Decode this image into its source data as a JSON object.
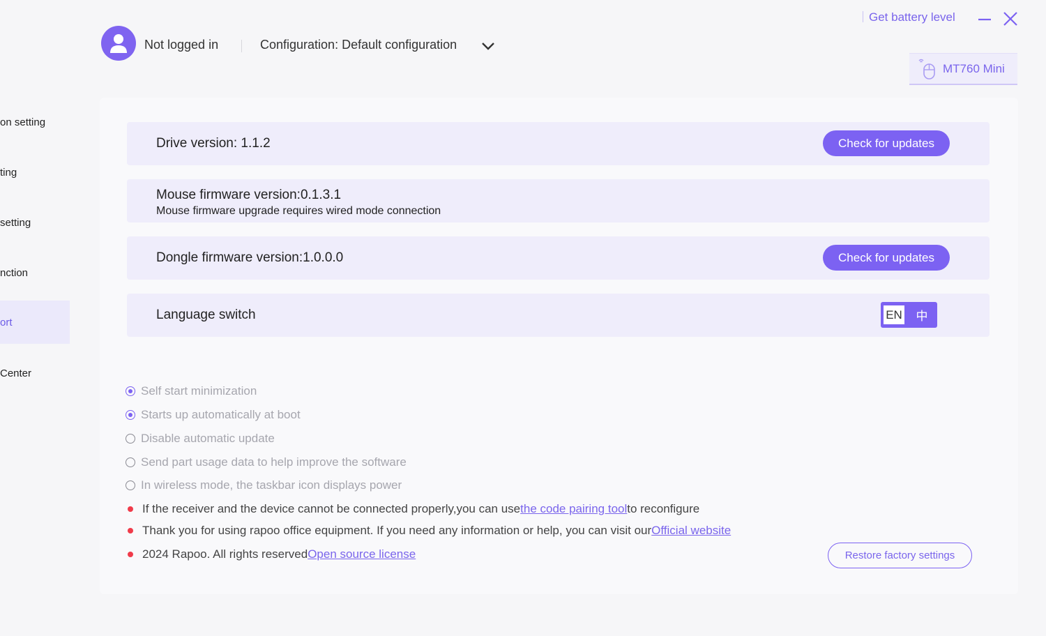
{
  "sidebar": {
    "items": [
      {
        "label": "on setting"
      },
      {
        "label": "ting"
      },
      {
        "label": "setting"
      },
      {
        "label": "nction"
      },
      {
        "label": "ort",
        "active": true
      },
      {
        "label": "Center"
      }
    ]
  },
  "header": {
    "user_status": "Not logged in",
    "configuration": "Configuration: Default configuration",
    "battery_link": "Get battery level",
    "device_name": "MT760 Mini"
  },
  "rows": {
    "drive_version": "Drive version: 1.1.2",
    "drive_button": "Check for updates",
    "mouse_firmware": "Mouse firmware version:0.1.3.1",
    "mouse_firmware_note": "Mouse firmware upgrade requires wired mode connection",
    "dongle_firmware": "Dongle firmware version:1.0.0.0",
    "dongle_button": "Check for updates",
    "language_label": "Language switch",
    "lang_en": "EN",
    "lang_zh": "中"
  },
  "options": [
    {
      "label": "Self start minimization",
      "checked": true
    },
    {
      "label": "Starts up automatically at boot",
      "checked": true
    },
    {
      "label": "Disable automatic update",
      "checked": false
    },
    {
      "label": "Send part usage data to help improve the software",
      "checked": false
    },
    {
      "label": "In wireless mode, the taskbar icon displays power",
      "checked": false
    }
  ],
  "notes": {
    "pairing_prefix": "If the receiver and the device cannot be connected properly,you can use",
    "pairing_link": "the code pairing tool",
    "pairing_suffix": "to reconfigure",
    "thanks_prefix": "Thank you for using rapoo office equipment. If you need any information or help, you can visit our",
    "thanks_link": "Official website",
    "copyright_prefix": "2024 Rapoo. All rights reserved",
    "copyright_link": "Open source license"
  },
  "restore_button": "Restore factory settings",
  "colors": {
    "accent": "#7c62f2",
    "row_background": "#efedfb",
    "bullet": "#f03b4a"
  }
}
